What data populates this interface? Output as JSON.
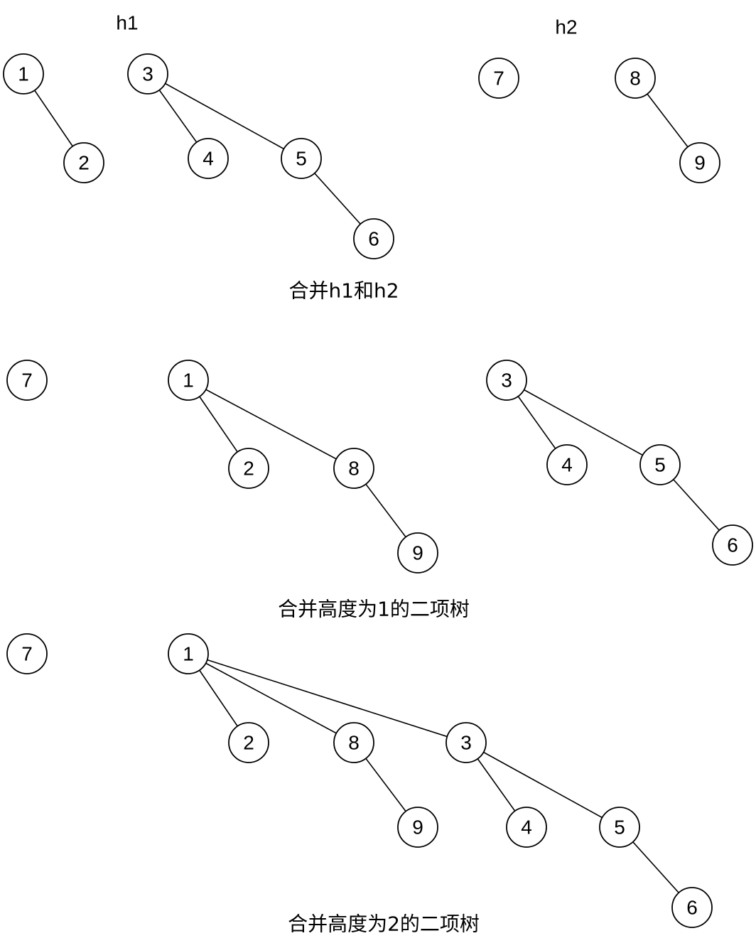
{
  "heap_labels": {
    "h1": "h1",
    "h2": "h2"
  },
  "captions": {
    "step1": "合并h1和h2",
    "step2": "合并高度为1的二项树",
    "step3": "合并高度为2的二项树"
  },
  "panels": [
    {
      "id": "initial",
      "nodes": [
        {
          "id": "a1",
          "value": "1"
        },
        {
          "id": "a2",
          "value": "2"
        },
        {
          "id": "a3",
          "value": "3"
        },
        {
          "id": "a4",
          "value": "4"
        },
        {
          "id": "a5",
          "value": "5"
        },
        {
          "id": "a6",
          "value": "6"
        },
        {
          "id": "a7",
          "value": "7"
        },
        {
          "id": "a8",
          "value": "8"
        },
        {
          "id": "a9",
          "value": "9"
        }
      ],
      "edges": [
        [
          "a1",
          "a2"
        ],
        [
          "a3",
          "a4"
        ],
        [
          "a3",
          "a5"
        ],
        [
          "a5",
          "a6"
        ],
        [
          "a8",
          "a9"
        ]
      ]
    },
    {
      "id": "after-merge-h1-h2",
      "nodes": [
        {
          "id": "b7",
          "value": "7"
        },
        {
          "id": "b1",
          "value": "1"
        },
        {
          "id": "b2",
          "value": "2"
        },
        {
          "id": "b8",
          "value": "8"
        },
        {
          "id": "b9",
          "value": "9"
        },
        {
          "id": "b3",
          "value": "3"
        },
        {
          "id": "b4",
          "value": "4"
        },
        {
          "id": "b5",
          "value": "5"
        },
        {
          "id": "b6",
          "value": "6"
        }
      ],
      "edges": [
        [
          "b1",
          "b2"
        ],
        [
          "b1",
          "b8"
        ],
        [
          "b8",
          "b9"
        ],
        [
          "b3",
          "b4"
        ],
        [
          "b3",
          "b5"
        ],
        [
          "b5",
          "b6"
        ]
      ]
    },
    {
      "id": "after-merge-height-1",
      "nodes": [
        {
          "id": "c7",
          "value": "7"
        },
        {
          "id": "c1",
          "value": "1"
        },
        {
          "id": "c2",
          "value": "2"
        },
        {
          "id": "c8",
          "value": "8"
        },
        {
          "id": "c9",
          "value": "9"
        },
        {
          "id": "c3",
          "value": "3"
        },
        {
          "id": "c4",
          "value": "4"
        },
        {
          "id": "c5",
          "value": "5"
        },
        {
          "id": "c6",
          "value": "6"
        }
      ],
      "edges": [
        [
          "c1",
          "c2"
        ],
        [
          "c1",
          "c8"
        ],
        [
          "c1",
          "c3"
        ],
        [
          "c8",
          "c9"
        ],
        [
          "c3",
          "c4"
        ],
        [
          "c3",
          "c5"
        ],
        [
          "c5",
          "c6"
        ]
      ]
    }
  ]
}
